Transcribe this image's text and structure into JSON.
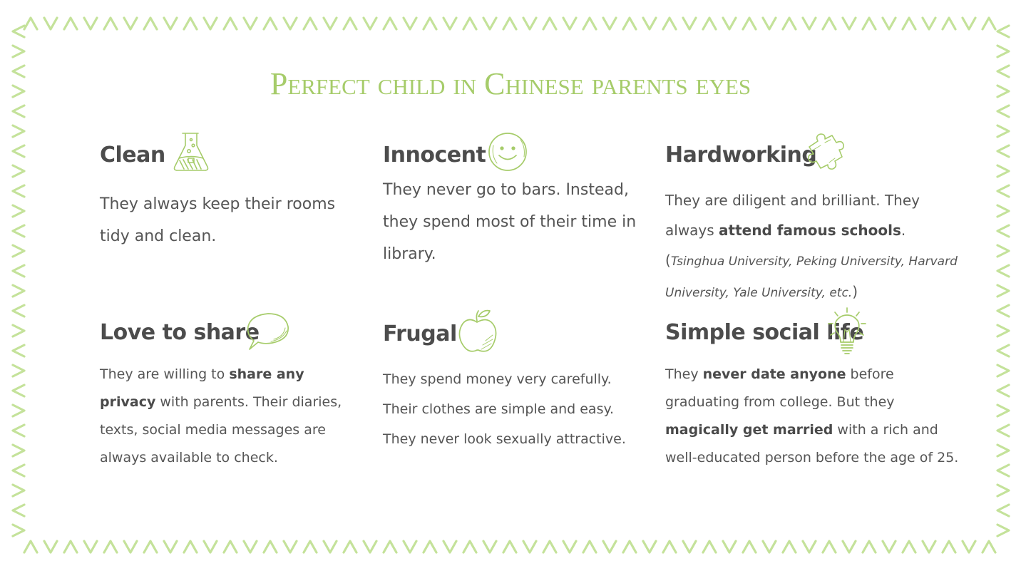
{
  "title": "Perfect child in Chinese parents eyes",
  "accent_color": "#a6cc6a",
  "text_color": "#505050",
  "cards": [
    {
      "heading": "Clean",
      "icon": "flask-icon",
      "text": "They always keep their rooms tidy and clean."
    },
    {
      "heading": "Innocent",
      "icon": "smiley-face-icon",
      "text": "They never go to bars. Instead, they spend most of their time in library."
    },
    {
      "heading": "Hardworking",
      "icon": "puzzle-piece-icon",
      "text_1": "They are diligent and brilliant. They always ",
      "bold_1": "attend famous schools",
      "text_2": ". (",
      "italic_1": "Tsinghua University, Peking University, Harvard University, Yale University, etc.",
      "text_3": ")"
    },
    {
      "heading": "Love to share",
      "icon": "speech-bubble-icon",
      "text_1": "They are willing to ",
      "bold_1": "share any privacy",
      "text_2": " with parents. Their diaries, texts, social media messages are always available to check."
    },
    {
      "heading": "Frugal",
      "icon": "apple-icon",
      "text": "They spend money very carefully. Their clothes are simple and easy. They never look sexually attractive."
    },
    {
      "heading": "Simple social life",
      "icon": "lightbulb-icon",
      "text_1": "They ",
      "bold_1": "never date anyone",
      "text_2": " before graduating from college. But they ",
      "bold_2": "magically get married",
      "text_3": " with a rich and well-educated person before the age of 25."
    }
  ]
}
